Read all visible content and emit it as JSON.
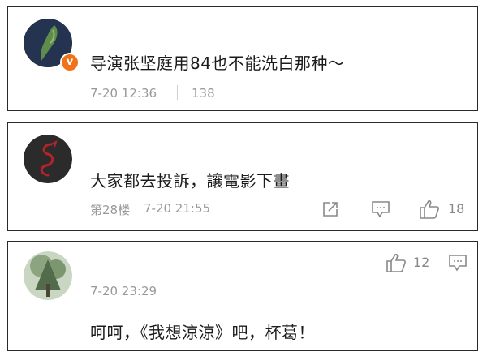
{
  "comments": [
    {
      "avatar_icon": "taiwan-map-icon",
      "badge_icon": "verified-v-badge-icon",
      "text": "导演张坚庭用84也不能洗白那种～",
      "time": "7-20 12:36",
      "count": "138"
    },
    {
      "avatar_icon": "red-dragon-avatar-icon",
      "text": "大家都去投訴，讓電影下畫",
      "floor": "第28楼",
      "time": "7-20 21:55",
      "likes": "18",
      "actions": [
        "share-icon",
        "comment-icon",
        "like-icon"
      ]
    },
    {
      "avatar_icon": "tree-photo-avatar-icon",
      "time": "7-20 23:29",
      "text": "呵呵，《我想涼涼》吧，杯葛！",
      "likes": "12",
      "actions": [
        "like-icon",
        "comment-icon"
      ]
    }
  ],
  "colors": {
    "badge": "#f0731a",
    "meta": "#999999",
    "border": "#2a2a2a"
  }
}
